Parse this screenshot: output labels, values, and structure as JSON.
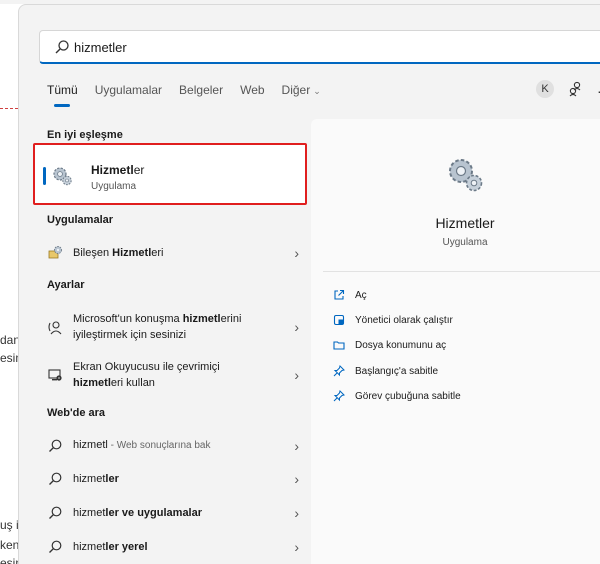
{
  "background": {
    "fragments": [
      "dan",
      "esim",
      "uş i",
      "ken s",
      "esim"
    ]
  },
  "search": {
    "value": "hizmetler",
    "icon": "search-icon"
  },
  "tabs": [
    {
      "label": "Tümü",
      "active": true
    },
    {
      "label": "Uygulamalar",
      "active": false
    },
    {
      "label": "Belgeler",
      "active": false
    },
    {
      "label": "Web",
      "active": false
    },
    {
      "label": "Diğer",
      "active": false,
      "dropdown": true
    }
  ],
  "header_right": {
    "avatar_letter": "K",
    "more": "···"
  },
  "sections": {
    "best_match": "En iyi eşleşme",
    "apps": "Uygulamalar",
    "settings": "Ayarlar",
    "web": "Web'de ara"
  },
  "best_match": {
    "name_bold": "Hizmetl",
    "name_rest": "er",
    "type": "Uygulama"
  },
  "apps": [
    {
      "pre": "Bileşen ",
      "bold": "Hizmetl",
      "post": "eri"
    }
  ],
  "settings": [
    {
      "line1_pre": "Microsoft'un konuşma ",
      "line1_bold": "hizmetl",
      "line1_post": "erini",
      "line2": "iyileştirmek için sesinizi"
    },
    {
      "line1_pre": "Ekran Okuyucusu ile çevrimiçi",
      "line1_bold": "",
      "line1_post": "",
      "line2_bold": "hizmetl",
      "line2_post": "eri kullan"
    }
  ],
  "web": [
    {
      "bold": "hizmetl",
      "muted": " - Web sonuçlarına bak"
    },
    {
      "pre": "hizmet",
      "bold": "ler"
    },
    {
      "pre": "hizmet",
      "bold": "ler ve uygulamalar"
    },
    {
      "pre": "hizmet",
      "bold": "ler yerel"
    }
  ],
  "detail": {
    "title": "Hizmetler",
    "type": "Uygulama",
    "actions": [
      {
        "label": "Aç",
        "icon": "open-external-icon"
      },
      {
        "label": "Yönetici olarak çalıştır",
        "icon": "shield-admin-icon"
      },
      {
        "label": "Dosya konumunu aç",
        "icon": "folder-icon"
      },
      {
        "label": "Başlangıç'a sabitle",
        "icon": "pin-icon"
      },
      {
        "label": "Görev çubuğuna sabitle",
        "icon": "pin-icon"
      }
    ]
  },
  "colors": {
    "accent": "#0067c0",
    "highlight_border": "#e01e1e"
  },
  "chevron": "›"
}
